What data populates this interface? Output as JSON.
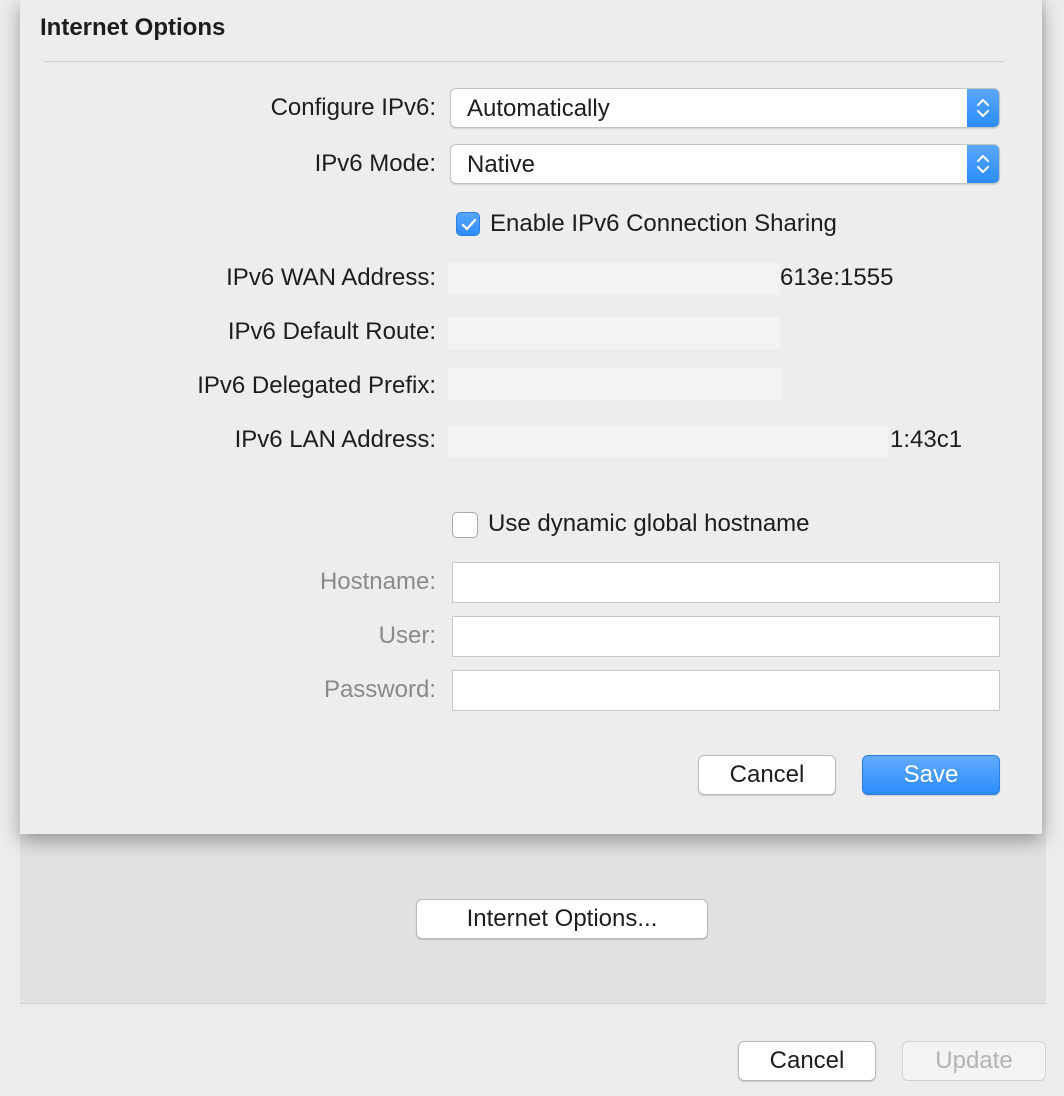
{
  "background": {
    "internet_options_button": "Internet Options...",
    "cancel_button": "Cancel",
    "update_button": "Update"
  },
  "sheet": {
    "title": "Internet Options",
    "configure_ipv6": {
      "label": "Configure IPv6:",
      "value": "Automatically"
    },
    "ipv6_mode": {
      "label": "IPv6 Mode:",
      "value": "Native"
    },
    "connection_sharing": {
      "label": "Enable IPv6 Connection Sharing",
      "checked": true
    },
    "info": {
      "wan_address": {
        "label": "IPv6 WAN Address:",
        "value": "613e:1555"
      },
      "default_route": {
        "label": "IPv6 Default Route:",
        "value": ""
      },
      "delegated_prefix": {
        "label": "IPv6 Delegated Prefix:",
        "value": ""
      },
      "lan_address": {
        "label": "IPv6 LAN Address:",
        "value": "1:43c1"
      }
    },
    "dynamic_hostname": {
      "label": "Use dynamic global hostname",
      "checked": false
    },
    "hostname": {
      "label": "Hostname:",
      "value": ""
    },
    "user": {
      "label": "User:",
      "value": ""
    },
    "password": {
      "label": "Password:",
      "value": ""
    },
    "cancel_button": "Cancel",
    "save_button": "Save"
  },
  "colors": {
    "accent": "#2b8cfb",
    "sheet_bg": "#ededed",
    "disabled_text": "#8a8a8a"
  }
}
